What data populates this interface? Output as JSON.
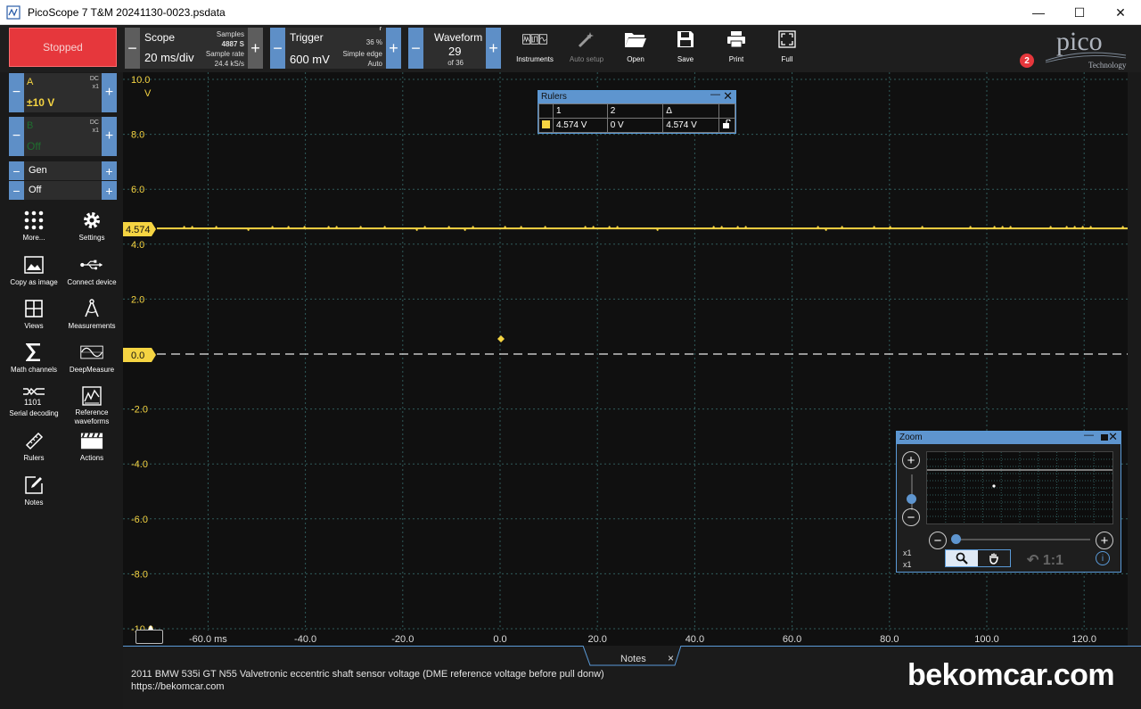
{
  "window": {
    "title": "PicoScope 7 T&M 20241130-0023.psdata",
    "minimize": "—",
    "maximize": "☐",
    "close": "✕"
  },
  "toolbar": {
    "stopped_label": "Stopped",
    "scope": {
      "label": "Scope",
      "value": "20 ms/div",
      "samples_label": "Samples",
      "samples_value": "4887 S",
      "rate_label": "Sample rate",
      "rate_value": "24.4 kS/s"
    },
    "trigger": {
      "label": "Trigger",
      "value": "600 mV",
      "percent": "36 %",
      "type": "Simple edge",
      "mode": "Auto"
    },
    "waveform": {
      "label": "Waveform",
      "value": "29",
      "of": "of 36"
    },
    "tools": [
      {
        "name": "instruments",
        "label": "Instruments"
      },
      {
        "name": "auto-setup",
        "label": "Auto setup"
      },
      {
        "name": "open",
        "label": "Open"
      },
      {
        "name": "save",
        "label": "Save"
      },
      {
        "name": "print",
        "label": "Print"
      },
      {
        "name": "full",
        "label": "Full"
      }
    ],
    "badge": "2",
    "logo_text": "pico",
    "logo_sub": "Technology"
  },
  "channels": {
    "a": {
      "name": "A",
      "coupling": "DC",
      "probe": "x1",
      "range": "±10 V"
    },
    "b": {
      "name": "B",
      "coupling": "DC",
      "probe": "x1",
      "range": "Off"
    },
    "gen": {
      "label": "Gen",
      "state": "Off"
    }
  },
  "sidebar_tools": [
    {
      "name": "more",
      "label": "More..."
    },
    {
      "name": "settings",
      "label": "Settings"
    },
    {
      "name": "copy-as-image",
      "label": "Copy as image"
    },
    {
      "name": "connect-device",
      "label": "Connect device"
    },
    {
      "name": "views",
      "label": "Views"
    },
    {
      "name": "measurements",
      "label": "Measurements"
    },
    {
      "name": "math-channels",
      "label": "Math channels"
    },
    {
      "name": "deepmeasure",
      "label": "DeepMeasure"
    },
    {
      "name": "serial-decoding",
      "label": "Serial decoding"
    },
    {
      "name": "reference-waveforms",
      "label": "Reference waveforms"
    },
    {
      "name": "rulers",
      "label": "Rulers"
    },
    {
      "name": "actions",
      "label": "Actions"
    },
    {
      "name": "notes",
      "label": "Notes"
    }
  ],
  "plot": {
    "y_unit": "V",
    "y_ticks": [
      "10.0",
      "8.0",
      "6.0",
      "4.0",
      "2.0",
      "0.0",
      "-2.0",
      "-4.0",
      "-6.0",
      "-8.0",
      "-10.0"
    ],
    "x_ticks": [
      "-60.0 ms",
      "-40.0",
      "-20.0",
      "0.0",
      "20.0",
      "40.0",
      "60.0",
      "80.0",
      "100.0",
      "120.0"
    ],
    "ruler_label": "4.574",
    "zero_label": "0.0",
    "trace_color": "#f5d442",
    "ruler_value_v": 4.574
  },
  "rulers_panel": {
    "title": "Rulers",
    "col1": "1",
    "col2": "2",
    "col_delta": "Δ",
    "val1": "4.574 V",
    "val2": "0 V",
    "delta": "4.574 V"
  },
  "zoom_panel": {
    "title": "Zoom",
    "x_factor": "x1",
    "y_factor": "x1",
    "reset_label": "1:1"
  },
  "notes": {
    "tab_label": "Notes",
    "close": "×",
    "line1": "2011 BMW 535i GT N55 Valvetronic eccentric shaft sensor voltage (DME reference voltage before pull donw)",
    "line2": "https://bekomcar.com"
  },
  "watermark": "bekomcar.com"
}
